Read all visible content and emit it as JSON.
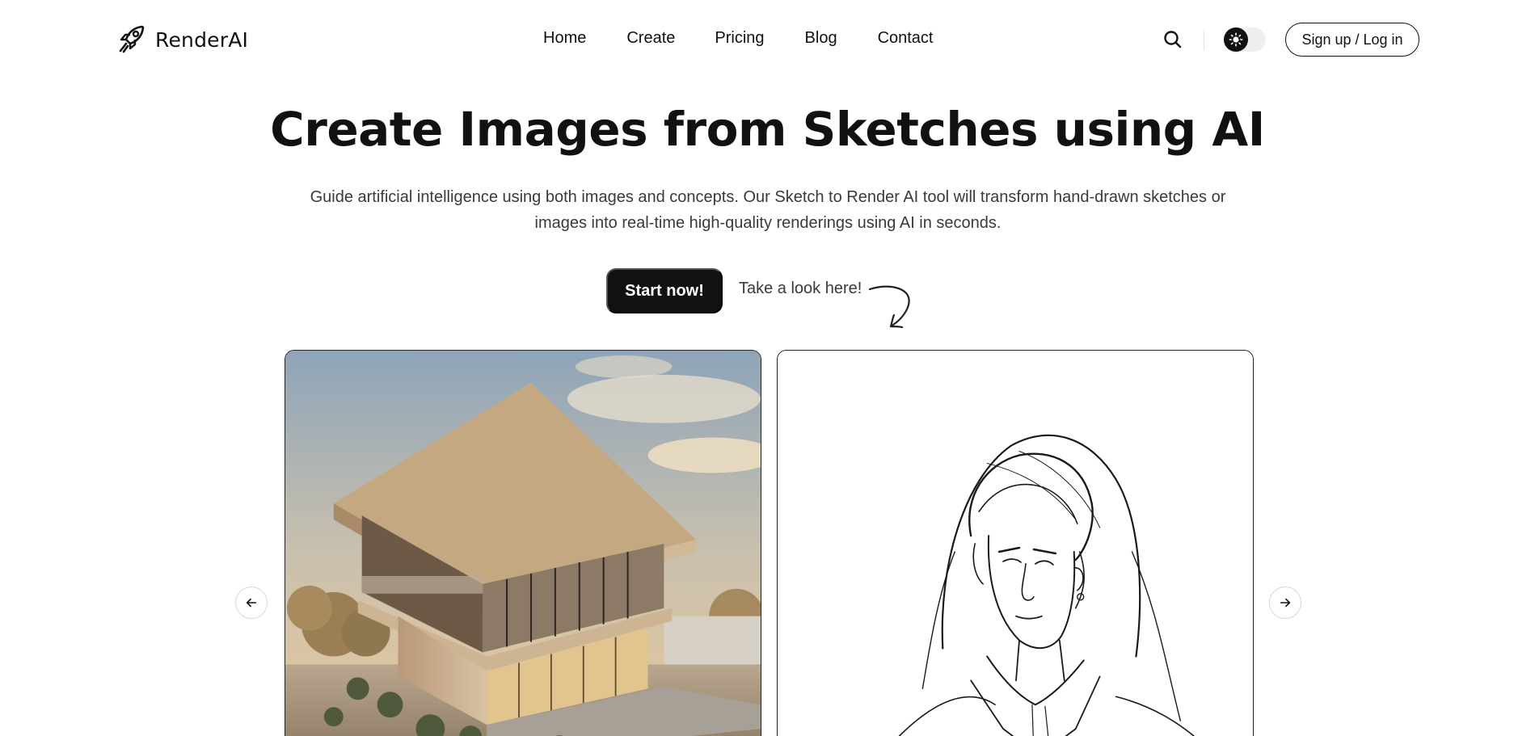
{
  "header": {
    "brand": "RenderAI",
    "brand_icon": "rocket-icon",
    "nav": [
      "Home",
      "Create",
      "Pricing",
      "Blog",
      "Contact"
    ],
    "search_icon": "search-icon",
    "theme_toggle_icon": "sun-icon",
    "auth_label": "Sign up / Log in"
  },
  "hero": {
    "title": "Create Images from Sketches using AI",
    "subtitle": "Guide artificial intelligence using both images and concepts. Our Sketch to Render AI tool will transform hand-drawn sketches or images into real-time high-quality renderings using AI in seconds.",
    "cta_label": "Start now!",
    "look_label": "Take a look here!"
  },
  "gallery": {
    "prev_icon": "arrow-left-icon",
    "next_icon": "arrow-right-icon"
  },
  "colors": {
    "primary": "#111111",
    "text_muted": "#3a3a3a",
    "border": "#d9d9d9"
  }
}
